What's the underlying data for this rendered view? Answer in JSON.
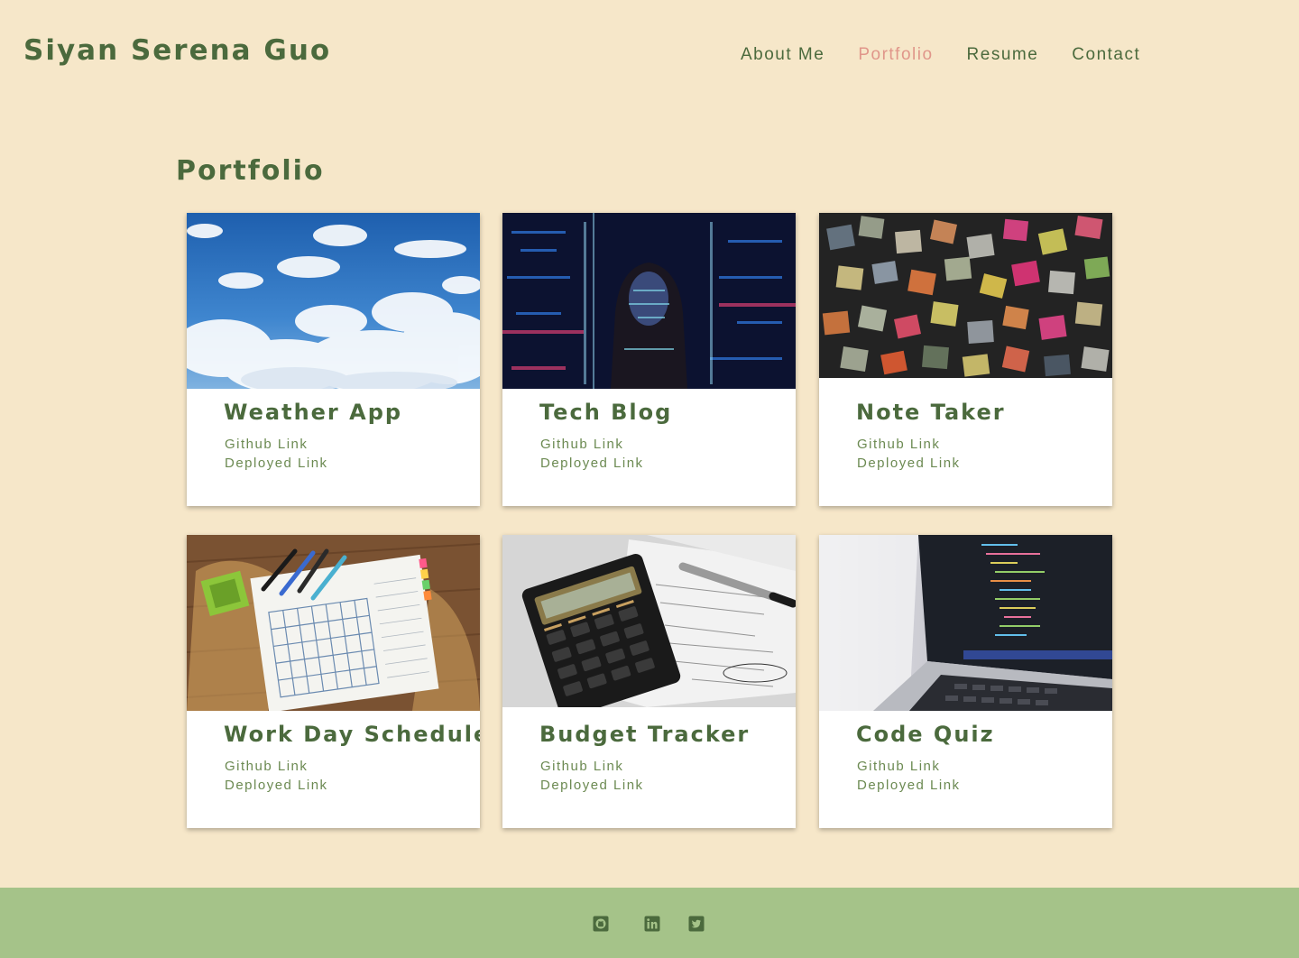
{
  "header": {
    "site_name": "Siyan Serena Guo"
  },
  "nav": {
    "items": [
      {
        "label": "About Me",
        "active": false
      },
      {
        "label": "Portfolio",
        "active": true
      },
      {
        "label": "Resume",
        "active": false
      },
      {
        "label": "Contact",
        "active": false
      }
    ]
  },
  "portfolio": {
    "title": "Portfolio",
    "projects": [
      {
        "title": "Weather App",
        "image": "sky-clouds-photo",
        "github_label": "Github Link",
        "deployed_label": "Deployed Link"
      },
      {
        "title": "Tech Blog",
        "image": "code-projection-photo",
        "github_label": "Github Link",
        "deployed_label": "Deployed Link"
      },
      {
        "title": "Note Taker",
        "image": "sticky-notes-photo",
        "github_label": "Github Link",
        "deployed_label": "Deployed Link"
      },
      {
        "title": "Work Day Schedule",
        "image": "planner-calendar-photo",
        "github_label": "Github Link",
        "deployed_label": "Deployed Link"
      },
      {
        "title": "Budget Tracker",
        "image": "calculator-photo",
        "github_label": "Github Link",
        "deployed_label": "Deployed Link"
      },
      {
        "title": "Code Quiz",
        "image": "laptop-code-photo",
        "github_label": "Github Link",
        "deployed_label": "Deployed Link"
      }
    ]
  },
  "footer": {
    "icons": [
      "github-icon",
      "linkedin-icon",
      "twitter-icon"
    ]
  },
  "colors": {
    "background": "#f6e7c9",
    "primary_green": "#4b6a3d",
    "link_green": "#6c8a52",
    "active_nav": "#e0968a",
    "footer": "#a5c389",
    "card": "#ffffff"
  }
}
